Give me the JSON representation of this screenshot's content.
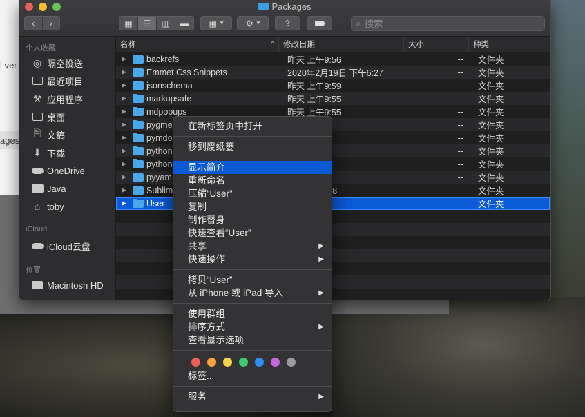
{
  "background": {
    "frag_ver": "l ver",
    "frag_ages": "ages"
  },
  "window": {
    "title": "Packages",
    "accent": "#0b5bd8"
  },
  "toolbar": {
    "search_placeholder": "搜索",
    "back_icon": "chevron-left-icon",
    "forward_icon": "chevron-right-icon",
    "view_modes": [
      "icon-view-icon",
      "list-view-icon",
      "column-view-icon",
      "gallery-view-icon"
    ],
    "active_view": 1
  },
  "sidebar": {
    "sections": [
      {
        "header": "个人收藏",
        "items": [
          {
            "label": "隔空投送",
            "icon": "airdrop-icon"
          },
          {
            "label": "最近项目",
            "icon": "recents-icon"
          },
          {
            "label": "应用程序",
            "icon": "applications-icon"
          },
          {
            "label": "桌面",
            "icon": "desktop-icon"
          },
          {
            "label": "文稿",
            "icon": "documents-icon"
          },
          {
            "label": "下载",
            "icon": "downloads-icon"
          },
          {
            "label": "OneDrive",
            "icon": "cloud-icon"
          },
          {
            "label": "Java",
            "icon": "folder-icon"
          },
          {
            "label": "toby",
            "icon": "home-icon"
          }
        ]
      },
      {
        "header": "iCloud",
        "items": [
          {
            "label": "iCloud云盘",
            "icon": "icloud-icon"
          }
        ]
      },
      {
        "header": "位置",
        "items": [
          {
            "label": "Macintosh HD",
            "icon": "disk-icon"
          },
          {
            "label": "网络",
            "icon": "network-icon"
          }
        ]
      }
    ]
  },
  "list": {
    "columns": {
      "name": "名称",
      "date": "修改日期",
      "size": "大小",
      "kind": "种类"
    },
    "rows": [
      {
        "name": "backrefs",
        "date": "昨天 上午9:56",
        "size": "--",
        "kind": "文件夹"
      },
      {
        "name": "Emmet Css Snippets",
        "date": "2020年2月19日 下午6:27",
        "size": "--",
        "kind": "文件夹"
      },
      {
        "name": "jsonschema",
        "date": "昨天 上午9:59",
        "size": "--",
        "kind": "文件夹"
      },
      {
        "name": "markupsafe",
        "date": "昨天 上午9:55",
        "size": "--",
        "kind": "文件夹"
      },
      {
        "name": "mdpopups",
        "date": "昨天 上午9:55",
        "size": "--",
        "kind": "文件夹"
      },
      {
        "name": "pygme",
        "date": "55",
        "size": "--",
        "kind": "文件夹"
      },
      {
        "name": "pymdo",
        "date": "55",
        "size": "--",
        "kind": "文件夹"
      },
      {
        "name": "python",
        "date": "55",
        "size": "--",
        "kind": "文件夹"
      },
      {
        "name": "python",
        "date": "55",
        "size": "--",
        "kind": "文件夹"
      },
      {
        "name": "pyyam",
        "date": "56",
        "size": "--",
        "kind": "文件夹"
      },
      {
        "name": "Sublim",
        "date": "9日 下午6:38",
        "size": "--",
        "kind": "文件夹"
      },
      {
        "name": "User",
        "date": "03",
        "size": "--",
        "kind": "文件夹"
      }
    ],
    "selected_index": 11
  },
  "context_menu": {
    "open_in_new_tab": "在新标签页中打开",
    "move_to_trash": "移到废纸篓",
    "get_info": "显示简介",
    "rename": "重新命名",
    "compress": "压缩“User”",
    "duplicate": "复制",
    "make_alias": "制作替身",
    "quick_look": "快速查看“User”",
    "share": "共享",
    "quick_actions": "快速操作",
    "copy": "拷贝“User”",
    "import_from_iphone": "从 iPhone 或 iPad 导入",
    "use_groups": "使用群组",
    "sort_by": "排序方式",
    "show_view_options": "查看显示选项",
    "tag_colors": [
      "#ee5f57",
      "#f6a23c",
      "#f5d545",
      "#3ec96e",
      "#2d8ef7",
      "#c866e0",
      "#9b9b9e"
    ],
    "tags": "标签...",
    "services": "服务"
  }
}
